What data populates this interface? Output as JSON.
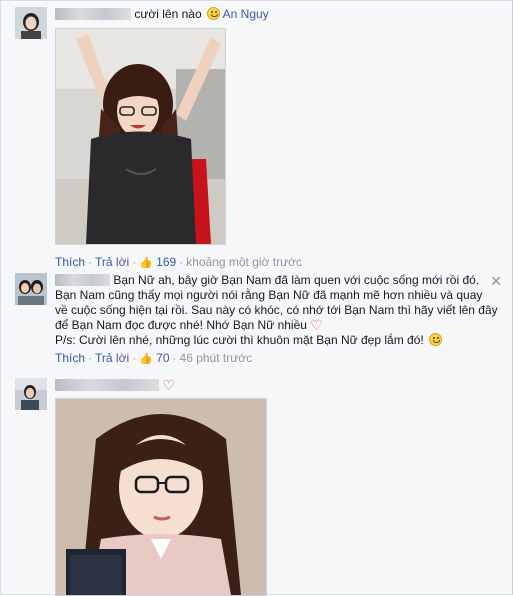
{
  "comments": [
    {
      "message": "cười lên nào",
      "tag": "An Nguy",
      "actions": {
        "like": "Thích",
        "reply": "Trả lời",
        "likes": "169",
        "time": "khoảng một giờ trước"
      }
    },
    {
      "lines": [
        "Bạn Nữ ah, bây giờ Bạn Nam đã làm quen với cuộc sống mới rồi đó.",
        "Bạn Nam cũng thấy mọi người nói rằng Bạn Nữ đã mạnh mẽ hơn nhiều và quay",
        "về cuộc sống hiện tại rồi. Sau này có khóc, có nhớ tới Bạn Nam thì hãy viết lên đây",
        "để Bạn Nam đọc được nhé! Nhớ Bạn Nữ nhiều",
        "P/s: Cười lên nhé, những lúc cười thì khuôn mặt Bạn Nữ đẹp lắm đó!"
      ],
      "actions": {
        "like": "Thích",
        "reply": "Trả lời",
        "likes": "70",
        "time": "46 phút trước"
      }
    },
    {
      "message": ""
    }
  ],
  "icons": [
    "smile-emoji-icon",
    "heart-emoji-icon",
    "like-thumb-icon",
    "close-icon"
  ],
  "colors": {
    "link": "#3b5998",
    "muted": "#90949c",
    "heart": "#e8536c"
  }
}
